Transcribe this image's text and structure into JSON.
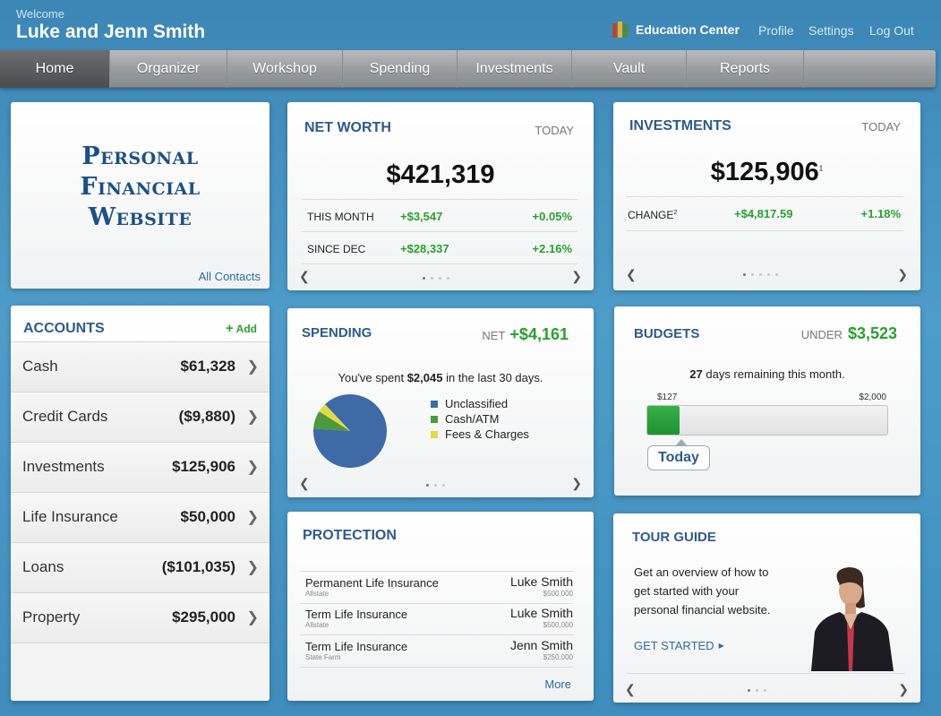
{
  "header": {
    "welcome": "Welcome",
    "user_name": "Luke and Jenn Smith",
    "education_center": "Education Center",
    "links": [
      "Profile",
      "Settings",
      "Log Out"
    ]
  },
  "nav": {
    "tabs": [
      "Home",
      "Organizer",
      "Workshop",
      "Spending",
      "Investments",
      "Vault",
      "Reports"
    ],
    "active": "Home"
  },
  "logo_card": {
    "lines": [
      "Personal",
      "Financial",
      "Website"
    ],
    "contacts_link": "All Contacts"
  },
  "net_worth": {
    "title": "NET WORTH",
    "period": "TODAY",
    "value": "$421,319",
    "rows": [
      {
        "label": "THIS MONTH",
        "amount": "+$3,547",
        "pct": "+0.05%"
      },
      {
        "label": "SINCE DEC",
        "amount": "+$28,337",
        "pct": "+2.16%"
      }
    ],
    "pager_active": 0,
    "pager_count": 4
  },
  "investments": {
    "title": "INVESTMENTS",
    "period": "TODAY",
    "value": "$125,906",
    "value_sup": "1",
    "change_label": "CHANGE",
    "change_sup": "2",
    "change_amount": "+$4,817.59",
    "change_pct": "+1.18%",
    "pager_active": 0,
    "pager_count": 5
  },
  "accounts": {
    "title": "ACCOUNTS",
    "add_label": "Add",
    "items": [
      {
        "name": "Cash",
        "value": "$61,328"
      },
      {
        "name": "Credit Cards",
        "value": "($9,880)"
      },
      {
        "name": "Investments",
        "value": "$125,906"
      },
      {
        "name": "Life Insurance",
        "value": "$50,000"
      },
      {
        "name": "Loans",
        "value": "($101,035)"
      },
      {
        "name": "Property",
        "value": "$295,000"
      }
    ]
  },
  "spending": {
    "title": "SPENDING",
    "net_label": "NET",
    "net_value": "+$4,161",
    "summary_pre": "You've spent ",
    "summary_amount": "$2,045",
    "summary_post": " in the last 30 days.",
    "legend": [
      {
        "label": "Unclassified",
        "color": "#3f6aa8"
      },
      {
        "label": "Cash/ATM",
        "color": "#4b9a3c"
      },
      {
        "label": "Fees & Charges",
        "color": "#e4d94a"
      }
    ],
    "pager_active": 0,
    "pager_count": 3
  },
  "chart_data": {
    "type": "pie",
    "categories": [
      "Unclassified",
      "Cash/ATM",
      "Fees & Charges"
    ],
    "values": [
      88,
      8,
      4
    ],
    "colors": [
      "#3f6aa8",
      "#4b9a3c",
      "#e4d94a"
    ]
  },
  "budgets": {
    "title": "BUDGETS",
    "under_label": "UNDER",
    "under_value": "$3,523",
    "days_number": "27",
    "days_text": " days remaining this month.",
    "spent_label": "$127",
    "limit_label": "$2,000",
    "progress_fraction": 0.135,
    "today_label": "Today"
  },
  "protection": {
    "title": "PROTECTION",
    "rows": [
      {
        "policy": "Permanent Life Insurance",
        "carrier": "Allstate",
        "insured": "Luke Smith",
        "amount": "$500,000"
      },
      {
        "policy": "Term Life Insurance",
        "carrier": "Allstate",
        "insured": "Luke Smith",
        "amount": "$500,000"
      },
      {
        "policy": "Term Life Insurance",
        "carrier": "State Farm",
        "insured": "Jenn Smith",
        "amount": "$250,000"
      }
    ],
    "more_label": "More"
  },
  "tour_guide": {
    "title": "TOUR GUIDE",
    "lines": [
      "Get an overview of how to",
      "get started with your",
      "personal financial website."
    ],
    "cta": "GET STARTED",
    "pager_active": 0,
    "pager_count": 3
  },
  "colors": {
    "brand_blue": "#2d5b8c",
    "positive_green": "#2aa02f",
    "background": "#4e9cc9"
  }
}
